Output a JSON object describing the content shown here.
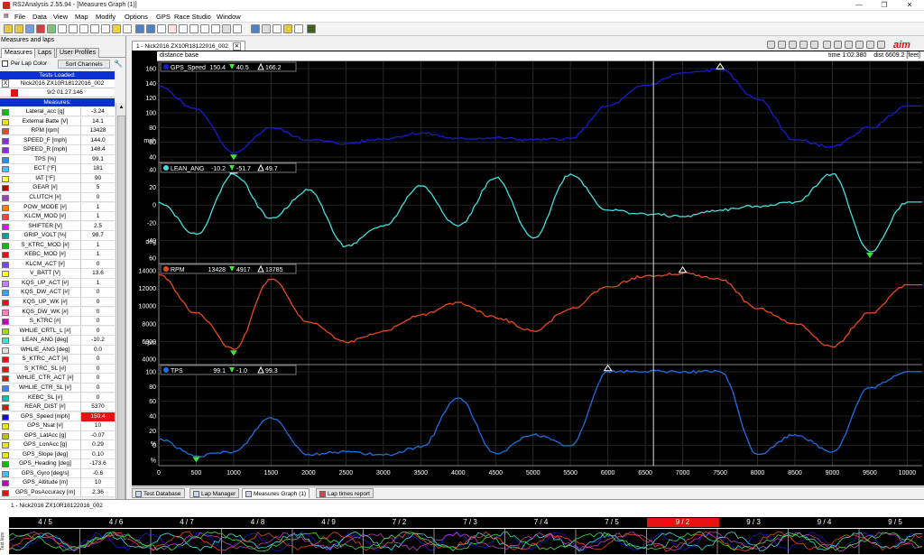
{
  "window": {
    "title": "RS2Analysis 2.55.94 - [Measures Graph (1)]",
    "minimize": "—",
    "maximize": "❐",
    "close": "✕"
  },
  "menu": [
    "File",
    "Data",
    "View",
    "Map",
    "Modify",
    "Options",
    "GPS",
    "Race Studio",
    "Window"
  ],
  "left_panel": {
    "title": "Measures and laps",
    "tabs": [
      "Measures",
      "Laps",
      "User Profiles"
    ],
    "per_lap_color": "Per Lap Color",
    "sort_channels": "Sort Channels",
    "tests_loaded_label": "Tests Loaded:",
    "test_marker": "X",
    "test_name": "Nick2016 ZX10R18122016_002",
    "lap_time": "9/2 01.27.146",
    "measures_label": "Measures:",
    "measures": [
      {
        "name": "Lateral_acc",
        "unit": "[g]",
        "value": "-3.24",
        "color": "#00c000"
      },
      {
        "name": "External Batte",
        "unit": "[V]",
        "value": "14.1",
        "color": "#e8e800"
      },
      {
        "name": "RPM",
        "unit": "[rpm]",
        "value": "13428",
        "color": "#e84a1a"
      },
      {
        "name": "SPEED_F",
        "unit": "[mph]",
        "value": "144.0",
        "color": "#8a2be2"
      },
      {
        "name": "SPEED_R",
        "unit": "[mph]",
        "value": "148.4",
        "color": "#8a2be2"
      },
      {
        "name": "TPS",
        "unit": "[%]",
        "value": "99.1",
        "color": "#1e90ff"
      },
      {
        "name": "ECT",
        "unit": "[°F]",
        "value": "181",
        "color": "#40c0ff"
      },
      {
        "name": "IAT",
        "unit": "[°F]",
        "value": "90",
        "color": "#ffff40"
      },
      {
        "name": "GEAR",
        "unit": "[#]",
        "value": "5",
        "color": "#c00000"
      },
      {
        "name": "CLUTCH",
        "unit": "[#]",
        "value": "0",
        "color": "#a040c0"
      },
      {
        "name": "POW_MODE",
        "unit": "[#]",
        "value": "1",
        "color": "#ff8000"
      },
      {
        "name": "KLCM_MOD",
        "unit": "[#]",
        "value": "1",
        "color": "#ff4040"
      },
      {
        "name": "SHIFTER",
        "unit": "[V]",
        "value": "2.5",
        "color": "#ff00ff"
      },
      {
        "name": "GRIP_VOLT",
        "unit": "[%]",
        "value": "98.7",
        "color": "#00a0a0"
      },
      {
        "name": "S_KTRC_MOD",
        "unit": "[#]",
        "value": "1",
        "color": "#00c000"
      },
      {
        "name": "KEBC_MOD",
        "unit": "[#]",
        "value": "1",
        "color": "#e81010"
      },
      {
        "name": "KLCM_ACT",
        "unit": "[#]",
        "value": "0",
        "color": "#8040ff"
      },
      {
        "name": "V_BATT",
        "unit": "[V]",
        "value": "13.6",
        "color": "#ffff00"
      },
      {
        "name": "KQS_UP_ACT",
        "unit": "[#]",
        "value": "1",
        "color": "#c080ff"
      },
      {
        "name": "KQS_DW_ACT",
        "unit": "[#]",
        "value": "0",
        "color": "#40a0ff"
      },
      {
        "name": "KQS_UP_WK",
        "unit": "[#]",
        "value": "0",
        "color": "#e81010"
      },
      {
        "name": "KQS_DW_WK",
        "unit": "[#]",
        "value": "0",
        "color": "#ff80c0"
      },
      {
        "name": "S_KTRC",
        "unit": "[#]",
        "value": "0",
        "color": "#c000c0"
      },
      {
        "name": "WHLIE_CRTL_L",
        "unit": "[#]",
        "value": "0",
        "color": "#a0e000"
      },
      {
        "name": "LEAN_ANG",
        "unit": "[deg]",
        "value": "-10.2",
        "color": "#40e0e0"
      },
      {
        "name": "WHLIE_ANG",
        "unit": "[deg]",
        "value": "0.0",
        "color": "#e0e0e0"
      },
      {
        "name": "S_KTRC_ACT",
        "unit": "[#]",
        "value": "0",
        "color": "#e81010"
      },
      {
        "name": "S_KTRC_SL",
        "unit": "[#]",
        "value": "0",
        "color": "#e81010"
      },
      {
        "name": "WHLIE_CTR_ACT",
        "unit": "[#]",
        "value": "0",
        "color": "#e81010"
      },
      {
        "name": "WHLIE_CTR_SL",
        "unit": "[#]",
        "value": "0",
        "color": "#4080ff"
      },
      {
        "name": "KEBC_SL",
        "unit": "[#]",
        "value": "0",
        "color": "#00c0c0"
      },
      {
        "name": "REAR_DIST",
        "unit": "[#]",
        "value": "5370",
        "color": "#e81010"
      },
      {
        "name": "GPS_Speed",
        "unit": "[mph]",
        "value": "150.4",
        "color": "#1010c0",
        "highlight": true
      },
      {
        "name": "GPS_Nsat",
        "unit": "[#]",
        "value": "10",
        "color": "#e8e800"
      },
      {
        "name": "GPS_LatAcc",
        "unit": "[g]",
        "value": "-0.07",
        "color": "#c0c000"
      },
      {
        "name": "GPS_LonAcc",
        "unit": "[g]",
        "value": "0.29",
        "color": "#e8e800"
      },
      {
        "name": "GPS_Slope",
        "unit": "[deg]",
        "value": "0.10",
        "color": "#e8e800"
      },
      {
        "name": "GPS_Heading",
        "unit": "[deg]",
        "value": "-173.6",
        "color": "#00c000"
      },
      {
        "name": "GPS_Gyro",
        "unit": "[deg/s]",
        "value": "-0.6",
        "color": "#40c0ff"
      },
      {
        "name": "GPS_Altitude",
        "unit": "[m]",
        "value": "10",
        "color": "#c000c0"
      },
      {
        "name": "GPS_PosAccuracy",
        "unit": "[m]",
        "value": "2.36",
        "color": "#e81010"
      }
    ]
  },
  "graph": {
    "tab": "1 - Nick2016 ZX10R18122016_002",
    "mode": "distance base",
    "time_readout": "time 1:02.380",
    "dist_readout": "dist 6609.2 [feet]",
    "brand": "aim"
  },
  "chart_data": {
    "type": "line",
    "xlabel": "",
    "x": [
      0,
      500,
      1000,
      1500,
      2000,
      2500,
      3000,
      3500,
      4000,
      4500,
      5000,
      5500,
      6000,
      6500,
      7000,
      7500,
      8000,
      8500,
      9000,
      9500,
      10000
    ],
    "xlim": [
      0,
      10200
    ],
    "x_ticks": [
      "0",
      "500",
      "1000",
      "1500",
      "2000",
      "2500",
      "3000",
      "3500",
      "4000",
      "4500",
      "5000",
      "5500",
      "6000",
      "6500",
      "7000",
      "7500",
      "8000",
      "8500",
      "9000",
      "9500",
      "10000"
    ],
    "cursor_x": 6609.2,
    "series": [
      {
        "name": "GPS_Speed",
        "unit": "mph",
        "color": "#1a1ad0",
        "readouts": [
          "150.4",
          "40.5",
          "166.2"
        ],
        "ylim": [
          35,
          170
        ],
        "y_ticks": [
          "160",
          "140",
          "120",
          "100",
          "80",
          "60",
          "40"
        ],
        "values": [
          138,
          105,
          40,
          78,
          60,
          55,
          62,
          70,
          62,
          63,
          60,
          62,
          110,
          140,
          158,
          163,
          120,
          60,
          50,
          78,
          110
        ]
      },
      {
        "name": "LEAN_ANG",
        "unit": "deg",
        "color": "#40e0e0",
        "readouts": [
          "-10.2",
          "-51.7",
          "49.7"
        ],
        "ylim": [
          -60,
          55
        ],
        "y_ticks": [
          "40",
          "20",
          "0",
          "-20",
          "-40",
          "60"
        ],
        "values": [
          10,
          -30,
          45,
          -10,
          25,
          -45,
          -20,
          30,
          -20,
          40,
          -35,
          45,
          0,
          -5,
          -8,
          0,
          5,
          10,
          45,
          -52,
          10
        ]
      },
      {
        "name": "RPM",
        "unit": "rpm",
        "color": "#e84a1a",
        "readouts": [
          "13428",
          "4917",
          "13785"
        ],
        "ylim": [
          3800,
          14200
        ],
        "y_ticks": [
          "14000",
          "12000",
          "10000",
          "8000",
          "6000",
          "4000"
        ],
        "values": [
          13400,
          9000,
          4900,
          12800,
          8000,
          5700,
          7000,
          8800,
          10200,
          8500,
          7000,
          9500,
          12000,
          13200,
          13500,
          12800,
          9500,
          7800,
          5200,
          9000,
          12200
        ]
      },
      {
        "name": "TPS",
        "unit": "%",
        "color": "#1e6fe0",
        "readouts": [
          "99.1",
          "-1.0",
          "99.3"
        ],
        "ylim": [
          -5,
          103
        ],
        "y_ticks": [
          "100",
          "80",
          "60",
          "40",
          "20",
          "0",
          "%"
        ],
        "values": [
          20,
          0,
          5,
          45,
          2,
          5,
          1,
          10,
          68,
          3,
          25,
          12,
          99,
          99,
          99,
          99,
          2,
          25,
          5,
          80,
          99
        ]
      }
    ]
  },
  "bottom_tabs": [
    "Test Database",
    "Lap Manager",
    "Measures Graph (1)",
    "Lap times report"
  ],
  "strip": {
    "name": "1 - Nick2016 ZX10R18122016_002",
    "laps": [
      "4 / 5",
      "4 / 6",
      "4 / 7",
      "4 / 8",
      "4 / 9",
      "7 / 2",
      "7 / 3",
      "7 / 4",
      "7 / 5",
      "9 / 2",
      "9 / 3",
      "9 / 4",
      "9 / 5"
    ],
    "selected_lap": "9 / 2",
    "side_label": "Test laps"
  }
}
